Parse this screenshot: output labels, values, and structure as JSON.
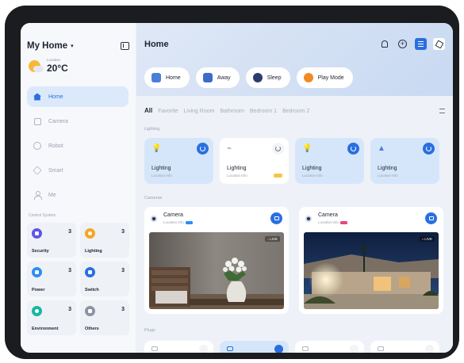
{
  "sidebar": {
    "home_title": "My Home",
    "weather": {
      "location_label": "Location",
      "temperature": "20°C"
    },
    "nav": [
      {
        "label": "Home",
        "icon": "home-icon",
        "active": true
      },
      {
        "label": "Camera",
        "icon": "camera-icon",
        "active": false
      },
      {
        "label": "Robot",
        "icon": "robot-icon",
        "active": false
      },
      {
        "label": "Smart",
        "icon": "smart-icon",
        "active": false
      },
      {
        "label": "Me",
        "icon": "user-icon",
        "active": false
      }
    ],
    "control_title": "Control System",
    "controls": [
      {
        "label": "Security",
        "count": "3",
        "color": "#5b55e8"
      },
      {
        "label": "Lighting",
        "count": "3",
        "color": "#f5a623"
      },
      {
        "label": "Power",
        "count": "3",
        "color": "#2a8ef2"
      },
      {
        "label": "Switch",
        "count": "3",
        "color": "#2a6fe0"
      },
      {
        "label": "Environment",
        "count": "3",
        "color": "#17b7a0"
      },
      {
        "label": "Others",
        "count": "3",
        "color": "#8c93a3"
      }
    ]
  },
  "main": {
    "title": "Home",
    "scenes": [
      {
        "label": "Home",
        "icon": "house-scene-icon",
        "color": "#4a7fd8"
      },
      {
        "label": "Away",
        "icon": "door-scene-icon",
        "color": "#3d6bc9"
      },
      {
        "label": "Sleep",
        "icon": "moon-scene-icon",
        "color": "#2c3c6e"
      },
      {
        "label": "Play Mode",
        "icon": "play-scene-icon",
        "color": "#f08a24"
      }
    ],
    "tabs": [
      "All",
      "Favorite",
      "Living Room",
      "Bathroom",
      "Bedroom 1",
      "Bedroom 2"
    ],
    "lighting_title": "Lighting",
    "lights": [
      {
        "title": "Lighting",
        "sub": "Location Info",
        "on": true,
        "icon": "bulb-icon"
      },
      {
        "title": "Lighting",
        "sub": "Location Info",
        "on": false,
        "icon": "lamp-icon"
      },
      {
        "title": "Lighting",
        "sub": "Location Info",
        "on": true,
        "icon": "bulb-icon"
      },
      {
        "title": "Lighting",
        "sub": "Location Info",
        "on": true,
        "icon": "ceiling-lamp-icon"
      }
    ],
    "cameras_title": "Cameras",
    "cameras": [
      {
        "title": "Camera",
        "sub": "Location Info",
        "badge_color": "#2a8ef2",
        "live": "LIVE"
      },
      {
        "title": "Camera",
        "sub": "Location Info",
        "badge_color": "#e8467c",
        "live": "LIVE"
      }
    ],
    "plugs_title": "Plugs"
  },
  "colors": {
    "accent": "#2a6fe0",
    "active_nav_bg": "#dbe9fb",
    "light_on_bg": "#d6e6fa"
  }
}
